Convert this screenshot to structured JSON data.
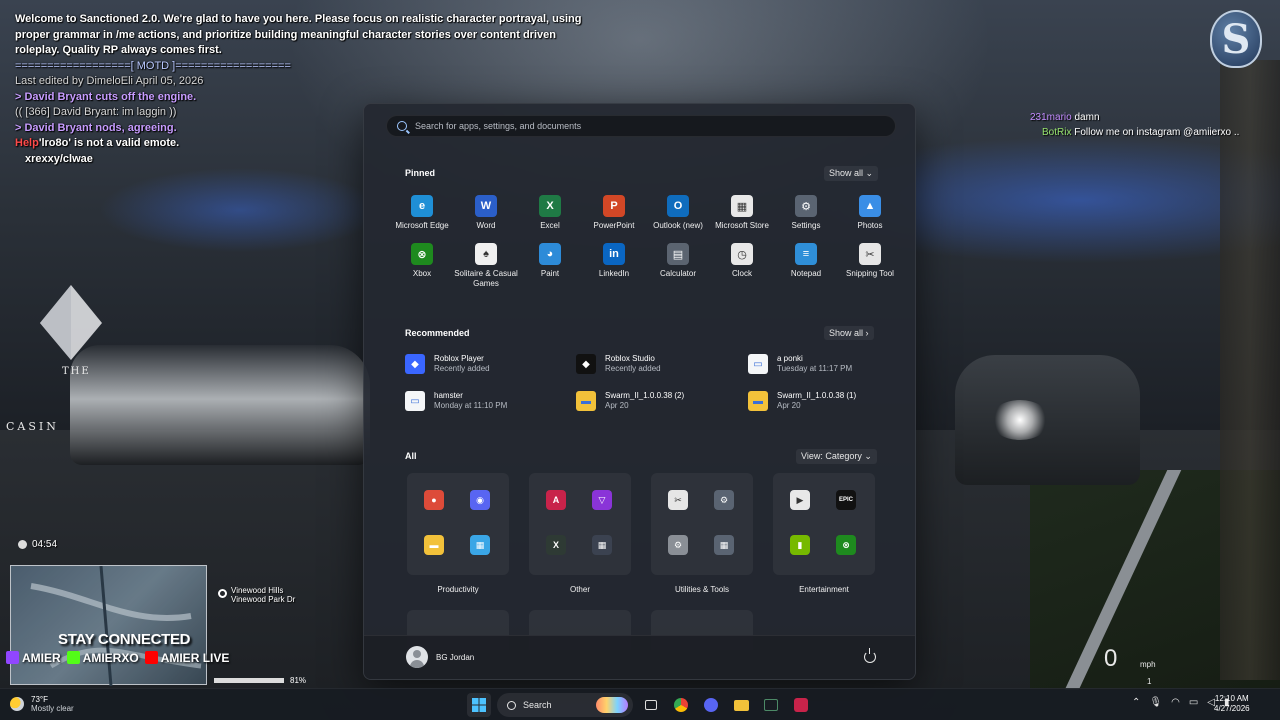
{
  "chat": {
    "motd": "Welcome to Sanctioned 2.0. We're glad to have you here. Please focus on realistic character portrayal, using proper grammar in /me actions, and prioritize building meaningful character stories over content driven roleplay. Quality RP always comes first.",
    "motd_divider": "==================[ MOTD ]==================",
    "edited": "Last edited by DimeloEli April 05, 2026",
    "lines": [
      {
        "text": "> David Bryant cuts off the engine.",
        "kind": "action"
      },
      {
        "text": "(( [366] David Bryant: im laggin ))",
        "kind": "ooc"
      },
      {
        "text": "> David Bryant nods, agreeing.",
        "kind": "action"
      }
    ],
    "help_prefix": "Help",
    "help_text": "'lro8o' is not a valid emote.",
    "last": "xrexxy/clwae"
  },
  "logo_letter": "S",
  "twitch": [
    {
      "user": "231mario",
      "msg": "damn"
    },
    {
      "user": "BotRix",
      "msg": "Follow me on instagram @amiierxo .."
    }
  ],
  "hud": {
    "time": "04:54",
    "street1": "Vinewood Hills",
    "street2": "Vinewood Park Dr",
    "stay": "STAY CONNECTED",
    "social1": "AMIER",
    "social2": "AMIERXO",
    "social3": "AMIER LIVE",
    "health_pct": "81%",
    "speed": "0",
    "unit": "mph",
    "gear": "1"
  },
  "bg": {
    "the": "THE",
    "casino": "CASIN"
  },
  "start": {
    "search_placeholder": "Search for apps, settings, and documents",
    "pinned_title": "Pinned",
    "show_all": "Show all ⌄",
    "pinned": [
      {
        "label": "Microsoft Edge",
        "glyph": "e",
        "color": "#1f8fd6"
      },
      {
        "label": "Word",
        "glyph": "W",
        "color": "#2b5fc9"
      },
      {
        "label": "Excel",
        "glyph": "X",
        "color": "#1f7a45"
      },
      {
        "label": "PowerPoint",
        "glyph": "P",
        "color": "#d24726"
      },
      {
        "label": "Outlook (new)",
        "glyph": "O",
        "color": "#0f6cbd"
      },
      {
        "label": "Microsoft Store",
        "glyph": "▦",
        "color": "#e8e8e8"
      },
      {
        "label": "Settings",
        "glyph": "⚙",
        "color": "#5a6472"
      },
      {
        "label": "Photos",
        "glyph": "▲",
        "color": "#3a8ee6"
      },
      {
        "label": "Xbox",
        "glyph": "⊗",
        "color": "#1e8a1e"
      },
      {
        "label": "Solitaire & Casual Games",
        "glyph": "♠",
        "color": "#f0f0f0"
      },
      {
        "label": "Paint",
        "glyph": "◕",
        "color": "#2d8bd8"
      },
      {
        "label": "LinkedIn",
        "glyph": "in",
        "color": "#0a66c2"
      },
      {
        "label": "Calculator",
        "glyph": "▤",
        "color": "#5b6470"
      },
      {
        "label": "Clock",
        "glyph": "◷",
        "color": "#e8e8e8"
      },
      {
        "label": "Notepad",
        "glyph": "≡",
        "color": "#2f8fd8"
      },
      {
        "label": "Snipping Tool",
        "glyph": "✂",
        "color": "#e6e6e6"
      }
    ],
    "rec_title": "Recommended",
    "rec_show_all": "Show all ›",
    "recommended": [
      {
        "title": "Roblox Player",
        "sub": "Recently added",
        "glyph": "◆",
        "color": "#3a66ff"
      },
      {
        "title": "Roblox Studio",
        "sub": "Recently added",
        "glyph": "◆",
        "color": "#111111"
      },
      {
        "title": "a ponki",
        "sub": "Tuesday at 11:17 PM",
        "glyph": "▭",
        "color": "#f4f6f8"
      },
      {
        "title": "hamster",
        "sub": "Monday at 11:10 PM",
        "glyph": "▭",
        "color": "#f4f6f8"
      },
      {
        "title": "Swarm_II_1.0.0.38 (2)",
        "sub": "Apr 20",
        "glyph": "▬",
        "color": "#f2c13a"
      },
      {
        "title": "Swarm_II_1.0.0.38 (1)",
        "sub": "Apr 20",
        "glyph": "▬",
        "color": "#f2c13a"
      }
    ],
    "all_title": "All",
    "view": "View: Category ⌄",
    "categories": [
      {
        "label": "Productivity",
        "icons": [
          {
            "name": "chrome-icon",
            "glyph": "●",
            "color": "#dd4b39"
          },
          {
            "name": "discord-icon",
            "glyph": "◉",
            "color": "#5865f2"
          },
          {
            "name": "file-explorer-icon",
            "glyph": "▬",
            "color": "#f2c13a"
          },
          {
            "name": "widgets-icon",
            "glyph": "▦",
            "color": "#3aa6e6"
          }
        ]
      },
      {
        "label": "Other",
        "icons": [
          {
            "name": "app-a-icon",
            "glyph": "A",
            "color": "#c8234a"
          },
          {
            "name": "app-v-icon",
            "glyph": "▽",
            "color": "#8a34d8"
          },
          {
            "name": "excel-outline-icon",
            "glyph": "X",
            "color": "#2e3a34"
          },
          {
            "name": "office-folder-icon",
            "glyph": "▦",
            "color": "#3b4250"
          }
        ]
      },
      {
        "label": "Utilities & Tools",
        "icons": [
          {
            "name": "snipping-icon",
            "glyph": "✂",
            "color": "#e6e6e6"
          },
          {
            "name": "settings-icon",
            "glyph": "⚙",
            "color": "#5a6472"
          },
          {
            "name": "control-icon",
            "glyph": "⚙",
            "color": "#8a8f96"
          },
          {
            "name": "tools-icon",
            "glyph": "▦",
            "color": "#5a6472"
          }
        ]
      },
      {
        "label": "Entertainment",
        "icons": [
          {
            "name": "media-player-icon",
            "glyph": "▶",
            "color": "#e8e8e8"
          },
          {
            "name": "epic-games-icon",
            "glyph": "EPIC",
            "color": "#111111"
          },
          {
            "name": "nvidia-icon",
            "glyph": "▮",
            "color": "#76b900"
          },
          {
            "name": "xbox-icon",
            "glyph": "⊗",
            "color": "#1e8a1e"
          }
        ]
      }
    ],
    "user": "BG Jordan"
  },
  "taskbar": {
    "temp": "73°F",
    "weather": "Mostly clear",
    "search": "Search",
    "time": "12:10 AM",
    "date": "4/27/2026"
  }
}
